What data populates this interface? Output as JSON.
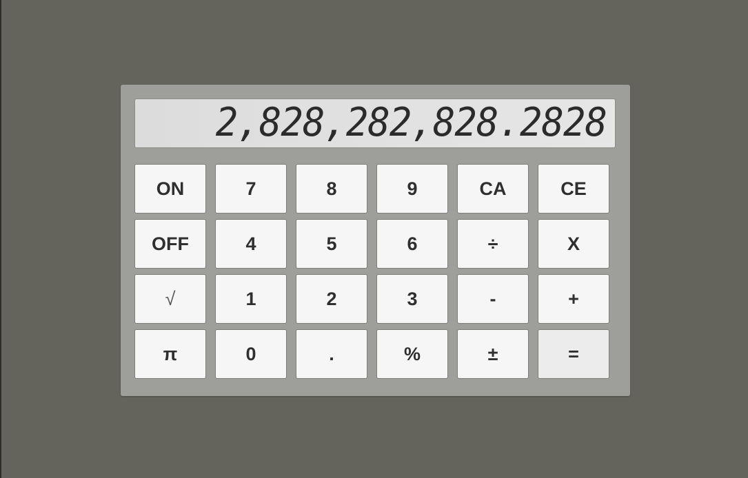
{
  "display": {
    "value": "2,828,282,828.2828"
  },
  "keys": {
    "on": "ON",
    "seven": "7",
    "eight": "8",
    "nine": "9",
    "ca": "CA",
    "ce": "CE",
    "off": "OFF",
    "four": "4",
    "five": "5",
    "six": "6",
    "divide": "÷",
    "multiply": "X",
    "sqrt": "√",
    "one": "1",
    "two": "2",
    "three": "3",
    "minus": "-",
    "plus": "+",
    "pi": "π",
    "zero": "0",
    "decimal": ".",
    "percent": "%",
    "plus_minus": "±",
    "equals": "="
  },
  "colors": {
    "background": "#64645c",
    "calculator_body": "#9e9e9a",
    "display_bg": "#e0e0e0",
    "key_bg": "#f6f6f6",
    "key_text": "#2f2f2f"
  }
}
